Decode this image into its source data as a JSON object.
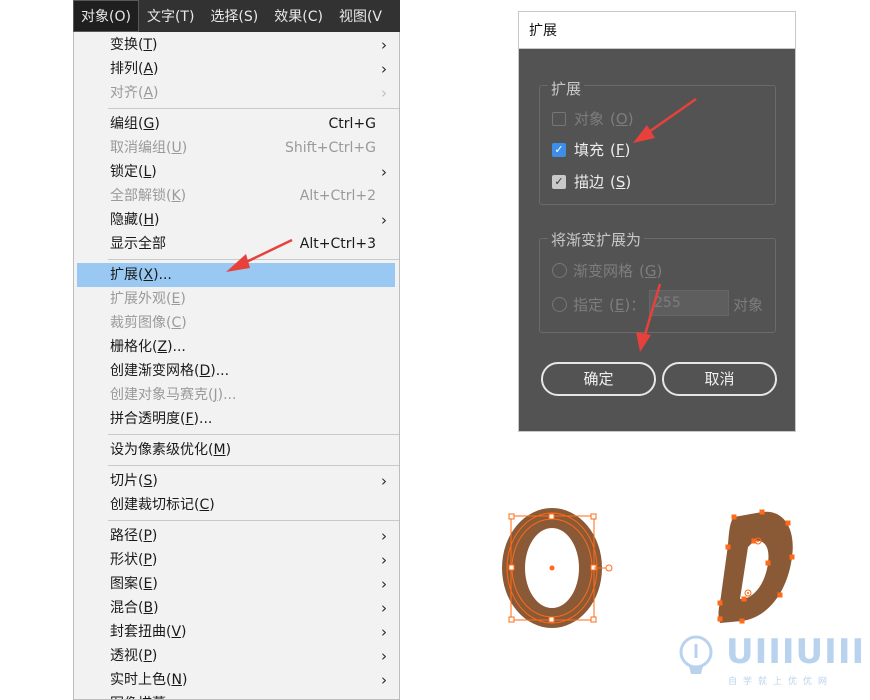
{
  "menubar": {
    "items": [
      "对象(O)",
      "文字(T)",
      "选择(S)",
      "效果(C)",
      "视图(V"
    ]
  },
  "menu": {
    "items": [
      {
        "pre": "变换(",
        "key": "T",
        "post": ")",
        "shortcut": "",
        "submenu": true,
        "disabled": false
      },
      {
        "pre": "排列(",
        "key": "A",
        "post": ")",
        "shortcut": "",
        "submenu": true,
        "disabled": false
      },
      {
        "pre": "对齐(",
        "key": "A",
        "post": ")",
        "shortcut": "",
        "submenu": true,
        "disabled": true
      },
      {
        "pre": "编组(",
        "key": "G",
        "post": ")",
        "shortcut": "Ctrl+G",
        "submenu": false,
        "disabled": false
      },
      {
        "pre": "取消编组(",
        "key": "U",
        "post": ")",
        "shortcut": "Shift+Ctrl+G",
        "submenu": false,
        "disabled": true
      },
      {
        "pre": "锁定(",
        "key": "L",
        "post": ")",
        "shortcut": "",
        "submenu": true,
        "disabled": false
      },
      {
        "pre": "全部解锁(",
        "key": "K",
        "post": ")",
        "shortcut": "Alt+Ctrl+2",
        "submenu": false,
        "disabled": true
      },
      {
        "pre": "隐藏(",
        "key": "H",
        "post": ")",
        "shortcut": "",
        "submenu": true,
        "disabled": false
      },
      {
        "pre": "显示全部",
        "key": "",
        "post": "",
        "shortcut": "Alt+Ctrl+3",
        "submenu": false,
        "disabled": false
      },
      {
        "pre": "扩展(",
        "key": "X",
        "post": ")...",
        "shortcut": "",
        "submenu": false,
        "disabled": false
      },
      {
        "pre": "扩展外观(",
        "key": "E",
        "post": ")",
        "shortcut": "",
        "submenu": false,
        "disabled": true
      },
      {
        "pre": "裁剪图像(",
        "key": "C",
        "post": ")",
        "shortcut": "",
        "submenu": false,
        "disabled": true
      },
      {
        "pre": "栅格化(",
        "key": "Z",
        "post": ")...",
        "shortcut": "",
        "submenu": false,
        "disabled": false
      },
      {
        "pre": "创建渐变网格(",
        "key": "D",
        "post": ")...",
        "shortcut": "",
        "submenu": false,
        "disabled": false
      },
      {
        "pre": "创建对象马赛克(",
        "key": "J",
        "post": ")...",
        "shortcut": "",
        "submenu": false,
        "disabled": true
      },
      {
        "pre": "拼合透明度(",
        "key": "F",
        "post": ")...",
        "shortcut": "",
        "submenu": false,
        "disabled": false
      },
      {
        "pre": "设为像素级优化(",
        "key": "M",
        "post": ")",
        "shortcut": "",
        "submenu": false,
        "disabled": false
      },
      {
        "pre": "切片(",
        "key": "S",
        "post": ")",
        "shortcut": "",
        "submenu": true,
        "disabled": false
      },
      {
        "pre": "创建裁切标记(",
        "key": "C",
        "post": ")",
        "shortcut": "",
        "submenu": false,
        "disabled": false
      },
      {
        "pre": "路径(",
        "key": "P",
        "post": ")",
        "shortcut": "",
        "submenu": true,
        "disabled": false
      },
      {
        "pre": "形状(",
        "key": "P",
        "post": ")",
        "shortcut": "",
        "submenu": true,
        "disabled": false
      },
      {
        "pre": "图案(",
        "key": "E",
        "post": ")",
        "shortcut": "",
        "submenu": true,
        "disabled": false
      },
      {
        "pre": "混合(",
        "key": "B",
        "post": ")",
        "shortcut": "",
        "submenu": true,
        "disabled": false
      },
      {
        "pre": "封套扭曲(",
        "key": "V",
        "post": ")",
        "shortcut": "",
        "submenu": true,
        "disabled": false
      },
      {
        "pre": "透视(",
        "key": "P",
        "post": ")",
        "shortcut": "",
        "submenu": true,
        "disabled": false
      },
      {
        "pre": "实时上色(",
        "key": "N",
        "post": ")",
        "shortcut": "",
        "submenu": true,
        "disabled": false
      },
      {
        "pre": "图像描摹",
        "key": "",
        "post": "",
        "shortcut": "",
        "submenu": true,
        "disabled": false
      }
    ],
    "highlighted_index": 9,
    "separators_after": [
      2,
      8,
      15,
      16,
      18
    ]
  },
  "dialog": {
    "title": "扩展",
    "expand_group": {
      "title": "扩展",
      "object": {
        "label": "对象",
        "key": "O"
      },
      "fill": {
        "label": "填充",
        "key": "F"
      },
      "stroke": {
        "label": "描边",
        "key": "S"
      }
    },
    "gradient_group": {
      "title": "将渐变扩展为",
      "mesh": {
        "label": "渐变网格",
        "key": "G"
      },
      "specify": {
        "label": "指定",
        "key": "E",
        "value": "255",
        "unit": "对象"
      }
    },
    "ok_label": "确定",
    "cancel_label": "取消"
  },
  "watermark": {
    "text": "UIIIUIII",
    "subtitle": "自学就上优优网"
  },
  "colors": {
    "menubar_bg": "#323232",
    "menu_bg": "#f2f2f2",
    "highlight": "#99c9f2",
    "dialog_bg": "#535353",
    "checkbox_blue": "#3d8ee8",
    "arrow_red": "#e8413b",
    "shape_fill": "#8a5a36",
    "selection_orange": "#ff6a1a"
  }
}
